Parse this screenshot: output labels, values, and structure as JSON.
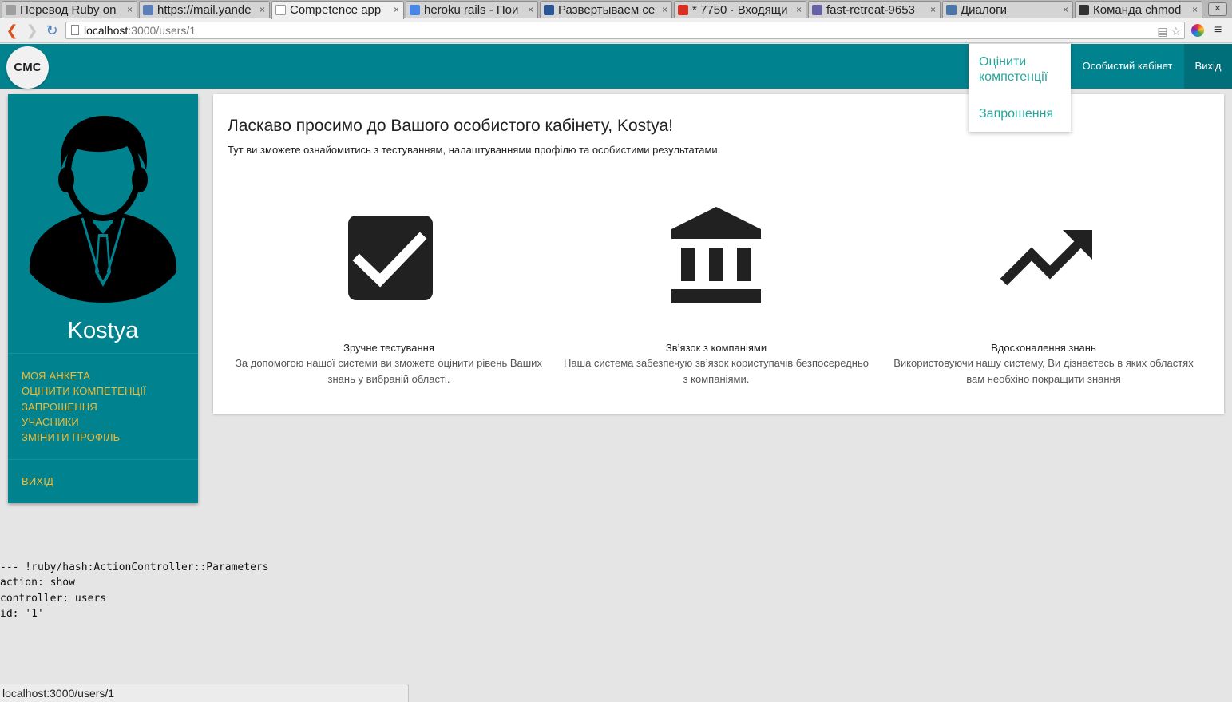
{
  "browser": {
    "tabs": [
      {
        "title": "Перевод Ruby on",
        "favicon_color": "#9e9e9e",
        "active": false
      },
      {
        "title": "https://mail.yande",
        "favicon_color": "#5c7fb8",
        "active": false
      },
      {
        "title": "Competence app",
        "favicon_color": "#ffffff",
        "active": true
      },
      {
        "title": "heroku rails - Пои",
        "favicon_color": "#4a86e8",
        "active": false
      },
      {
        "title": "Развертываем се",
        "favicon_color": "#2b5797",
        "active": false
      },
      {
        "title": "* 7750 · Входящи",
        "favicon_color": "#d93025",
        "active": false
      },
      {
        "title": "fast-retreat-9653",
        "favicon_color": "#6762a6",
        "active": false
      },
      {
        "title": "Диалоги",
        "favicon_color": "#4a76a8",
        "active": false
      },
      {
        "title": "Команда chmod",
        "favicon_color": "#333333",
        "active": false
      }
    ],
    "tab_close": "×",
    "window_close": "✕",
    "back": "❮",
    "forward": "❯",
    "reload": "↻",
    "url_host": "localhost",
    "url_path": ":3000/users/1",
    "omnibox_icons": "▤ ☆",
    "menu_glyph": "≡",
    "status_url": "localhost:3000/users/1"
  },
  "header": {
    "logo": "CMC",
    "nav_cabinet": "Особистий кабінет",
    "nav_exit": "Вихід",
    "color": "#00838f"
  },
  "dropdown": {
    "items": [
      "Оцінити компетенції",
      "Запрошення"
    ],
    "color": "#26a69a"
  },
  "sidebar": {
    "user_name": "Kostya",
    "avatar_icon": "user-avatar-icon",
    "links": [
      "МОЯ АНКЕТА",
      "ОЦІНИТИ КОМПЕТЕНЦІЇ",
      "ЗАПРОШЕННЯ",
      "УЧАСНИКИ",
      "ЗМІНИТИ ПРОФІЛЬ"
    ],
    "logout": "ВИХІД",
    "link_color": "#f5b82e"
  },
  "main": {
    "title": "Ласкаво просимо до Вашого особистого кабінету, Kostya!",
    "subtitle": "Тут ви зможете ознайомитись з тестуванням, налаштуваннями профілю та особистими результатами.",
    "features": [
      {
        "icon": "check-box-icon",
        "title": "Зручне тестування",
        "line1": "За допомогою нашої системи ви зможете оцінити рівень Ваших",
        "line2": "знань у вибраній області."
      },
      {
        "icon": "bank-icon",
        "title": "Зв’язок з компаніями",
        "line1": "Наша система забезпечую зв’язок користупачів безпосередньо",
        "line2": "з компаніями."
      },
      {
        "icon": "trending-up-icon",
        "title": "Вдосконалення знань",
        "line1": "Використовуючи нашу систему, Ви дізнаєтесь в яких областях",
        "line2": "вам необхіно покращити знання"
      }
    ]
  },
  "debug": {
    "lines": [
      "--- !ruby/hash:ActionController::Parameters",
      "action: show",
      "controller: users",
      "id: '1'"
    ]
  }
}
